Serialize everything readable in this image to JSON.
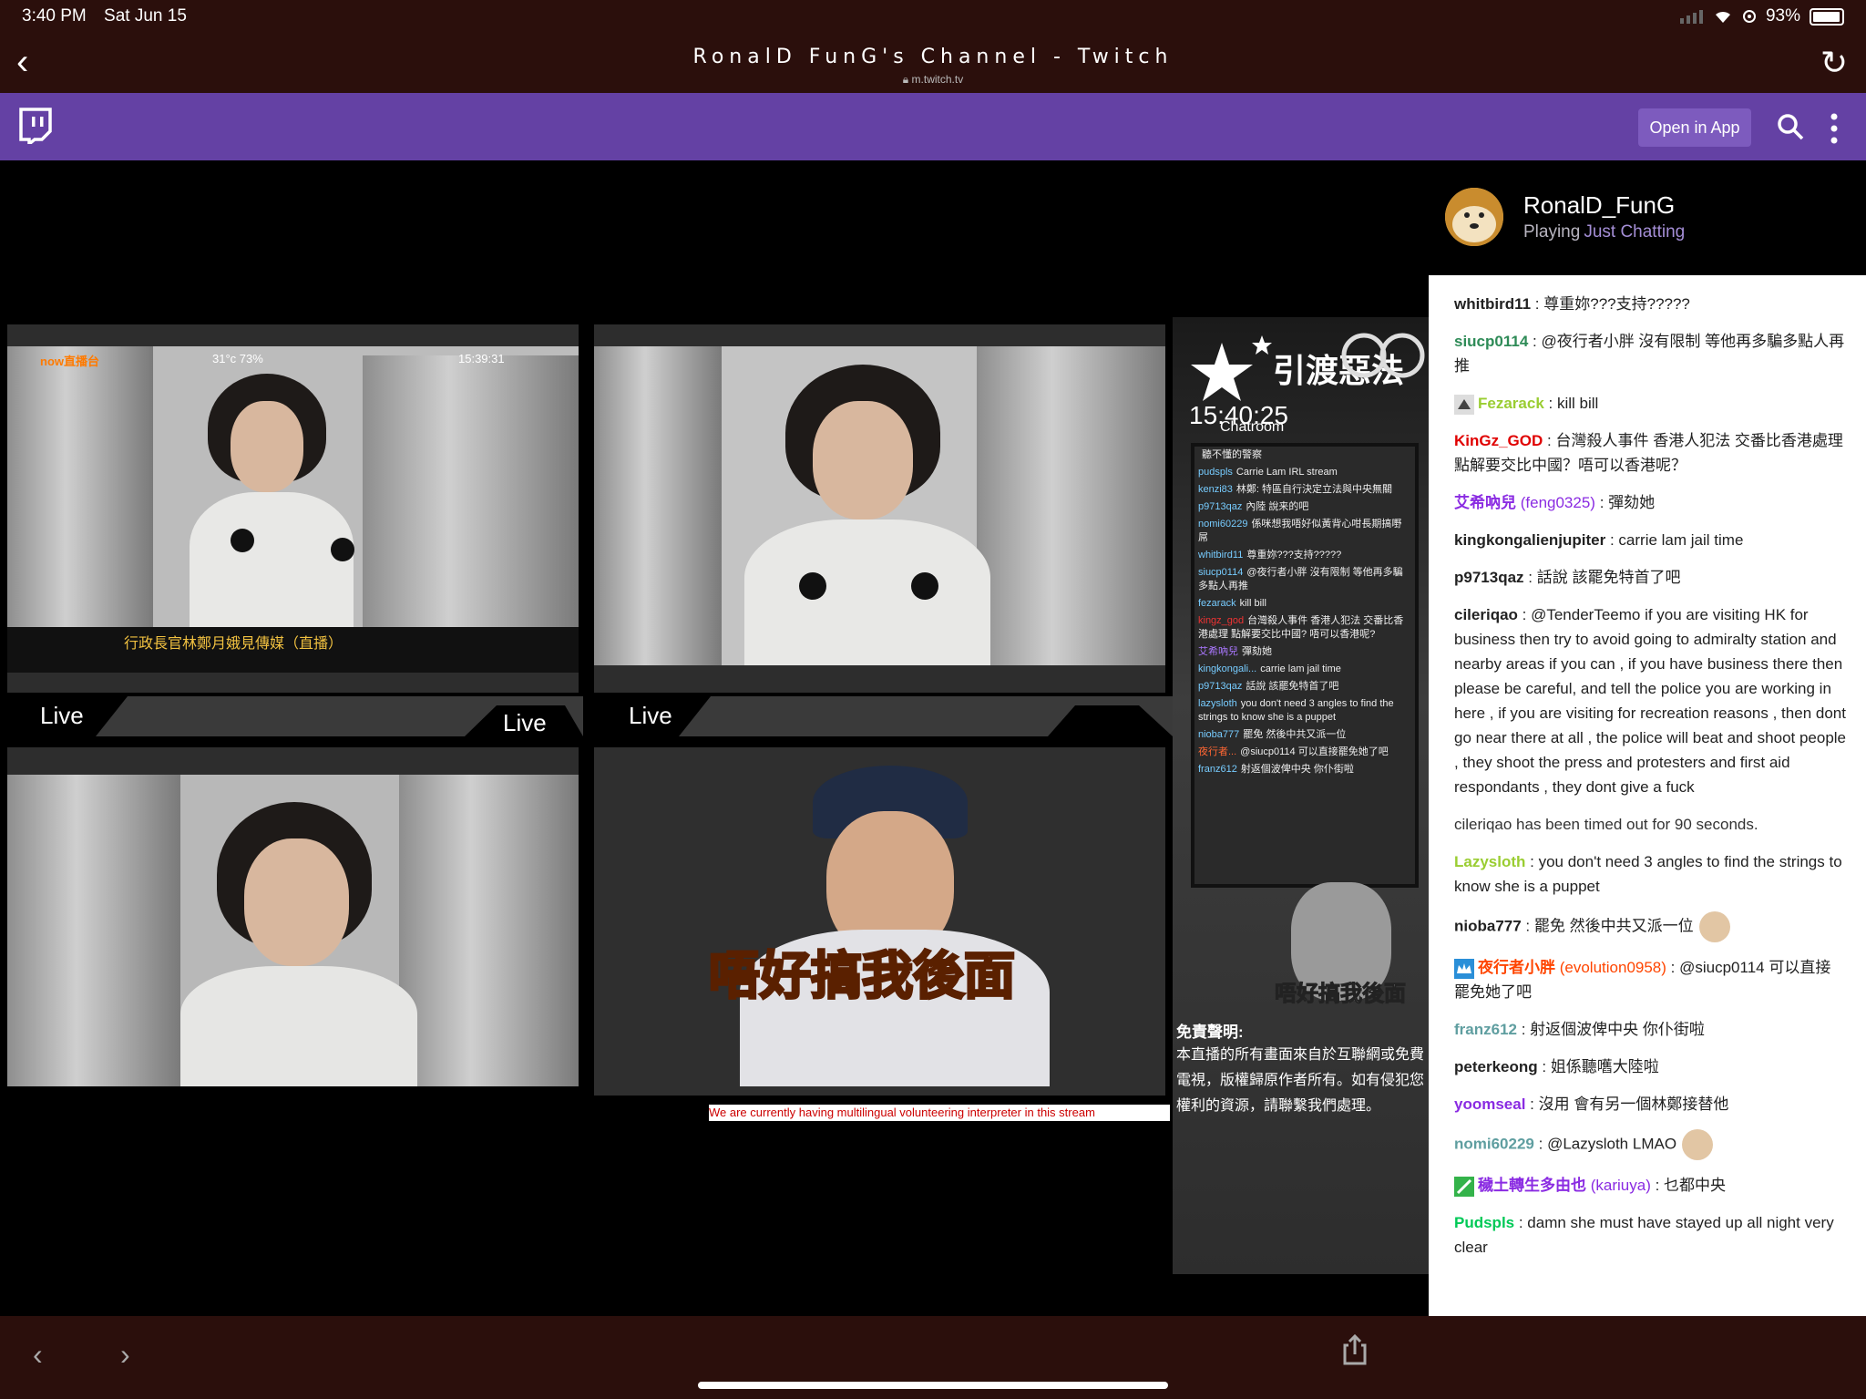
{
  "status_bar": {
    "time": "3:40 PM",
    "date": "Sat Jun 15",
    "battery": "93%"
  },
  "browser": {
    "title": "RonalD FunG's Channel - Twitch",
    "url": "m.twitch.tv"
  },
  "twitch_bar": {
    "open_in_app": "Open in App"
  },
  "stream": {
    "live_labels": [
      "Live",
      "Live",
      "Live"
    ],
    "panel1_overlay": {
      "temp": "31°c 73%",
      "clock": "15:39:31",
      "logo": "now直播台",
      "caption": "行政長官林鄭月娥見傳媒（直播）"
    },
    "meme_caption": "唔好搞我後面",
    "ticker": "We are currently having multilingual volunteering interpreter in this stream",
    "overlay": {
      "banner": "引渡惡法",
      "time": "15:40:25",
      "chatroom_title": "Chatroom",
      "meme_caption": "唔好搞我後面",
      "disclaimer_title": "免責聲明:",
      "disclaimer_body": "本直播的所有畫面來自於互聯網或免費電視，版權歸原作者所有。如有侵犯您權利的資源，請聯繫我們處理。",
      "chat": [
        {
          "u": "",
          "t": "聽不懂的警察"
        },
        {
          "u": "pudspls",
          "t": "Carrie Lam IRL stream"
        },
        {
          "u": "kenzi83",
          "t": "林鄭: 特區自行決定立法與中央無關"
        },
        {
          "u": "p9713qaz",
          "t": "內陸 說来的吧"
        },
        {
          "u": "nomi60229",
          "t": "係咪想我唔好似黃背心咁長期搞嘢屌"
        },
        {
          "u": "whitbird11",
          "t": "尊重妳???支持?????"
        },
        {
          "u": "siucp0114",
          "t": "@夜行者小胖 沒有限制 等他再多騙多點人再推"
        },
        {
          "u": "fezarack",
          "t": "kill bill"
        },
        {
          "u": "kingz_god",
          "t": "台灣殺人事件 香港人犯法 交番比香港處理 點解要交比中國? 唔可以香港呢?"
        },
        {
          "u": "艾希吶兒",
          "t": "彈劾她"
        },
        {
          "u": "kingkongali...",
          "t": "carrie lam jail time"
        },
        {
          "u": "p9713qaz",
          "t": "話說 該罷免特首了吧"
        },
        {
          "u": "lazysloth",
          "t": "you don't need 3 angles to find the strings to know she is a puppet"
        },
        {
          "u": "nioba777",
          "t": "罷免 然後中共又派一位"
        },
        {
          "u": "夜行者...",
          "t": "@siucp0114 可以直接罷免她了吧"
        },
        {
          "u": "franz612",
          "t": "射返個波俾中央 你仆街啦"
        }
      ]
    }
  },
  "channel": {
    "name": "RonalD_FunG",
    "playing_label": "Playing",
    "game": "Just Chatting"
  },
  "chat": [
    {
      "user": "whitbird11",
      "color": "#222222",
      "text": "尊重妳???支持?????"
    },
    {
      "user": "siucp0114",
      "color": "#2e8b57",
      "text": "@夜行者小胖 沒有限制 等他再多騙多點人再推"
    },
    {
      "user": "Fezarack",
      "color": "#9acd32",
      "text": "kill bill",
      "badge": "arrow"
    },
    {
      "user": "KinGz_GOD",
      "color": "#e00000",
      "text": "台灣殺人事件 香港人犯法 交番比香港處理 點解要交比中國？唔可以香港呢？"
    },
    {
      "user": "艾希吶兒",
      "sub": "(feng0325)",
      "color": "#8a2be2",
      "text": "彈劾她"
    },
    {
      "user": "kingkongalienjupiter",
      "color": "#222222",
      "text": "carrie lam jail time"
    },
    {
      "user": "p9713qaz",
      "color": "#222222",
      "text": "話說 該罷免特首了吧"
    },
    {
      "user": "cileriqao",
      "color": "#222222",
      "text": "@TenderTeemo if you are visiting HK for business then try to avoid going to admiralty station and nearby areas if you can , if you have business there then please be careful, and tell the police you are working in here , if you are visiting for recreation reasons , then dont go near there at all , the police will beat and shoot people , they shoot the press and protesters and first aid respondants , they dont give a fuck"
    },
    {
      "notice": "cileriqao has been timed out for 90 seconds."
    },
    {
      "user": "Lazysloth",
      "color": "#9acd32",
      "text": "you don't need 3 angles to find the strings to know she is a puppet"
    },
    {
      "user": "nioba777",
      "color": "#222222",
      "text": "罷免 然後中共又派一位",
      "emote": true
    },
    {
      "user": "夜行者小胖",
      "sub": "(evolution0958)",
      "color": "#ff4500",
      "text": "@siucp0114 可以直接罷免她了吧",
      "badge": "crown"
    },
    {
      "user": "franz612",
      "color": "#5f9ea0",
      "text": "射返個波俾中央 你仆街啦"
    },
    {
      "user": "peterkeong",
      "color": "#222222",
      "text": "姐係聽嚿大陸啦"
    },
    {
      "user": "yoomseal",
      "color": "#8a2be2",
      "text": "沒用 會有另一個林鄭接替他"
    },
    {
      "user": "nomi60229",
      "color": "#5f9ea0",
      "text": "@Lazysloth LMAO",
      "emote": true
    },
    {
      "user": "穢土轉生多由也",
      "sub": "(kariuya)",
      "color": "#8a2be2",
      "text": "乜都中央",
      "badge": "sword"
    },
    {
      "user": "Pudspls",
      "color": "#00c957",
      "text": "damn she must have stayed up all night very clear"
    }
  ]
}
